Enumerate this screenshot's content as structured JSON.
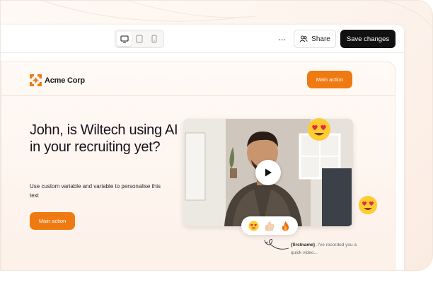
{
  "toolbar": {
    "devices": [
      {
        "name": "desktop",
        "active": true
      },
      {
        "name": "tablet",
        "active": false
      },
      {
        "name": "mobile",
        "active": false
      }
    ],
    "more_label": "···",
    "share_label": "Share",
    "save_label": "Save changes"
  },
  "site": {
    "brand": "Acme Corp",
    "brand_color": "#f07a12",
    "header_action_label": "Main action",
    "headline": "John, is Wiltech using AI in your recruiting yet?",
    "subtext": "Use custom variable and variable to personalise this text",
    "body_action_label": "Main action"
  },
  "video": {
    "play_icon": "play-icon",
    "reactions": [
      "heart-eyes-emoji",
      "thumbs-up-emoji",
      "fire-emoji"
    ],
    "floating_emojis": [
      "heart-eyes-emoji",
      "heart-eyes-emoji"
    ]
  },
  "note": {
    "variable": "{firstname}",
    "text": ", I've recorded you a quick video..."
  },
  "colors": {
    "accent": "#f07a12",
    "dark_button": "#111111"
  }
}
